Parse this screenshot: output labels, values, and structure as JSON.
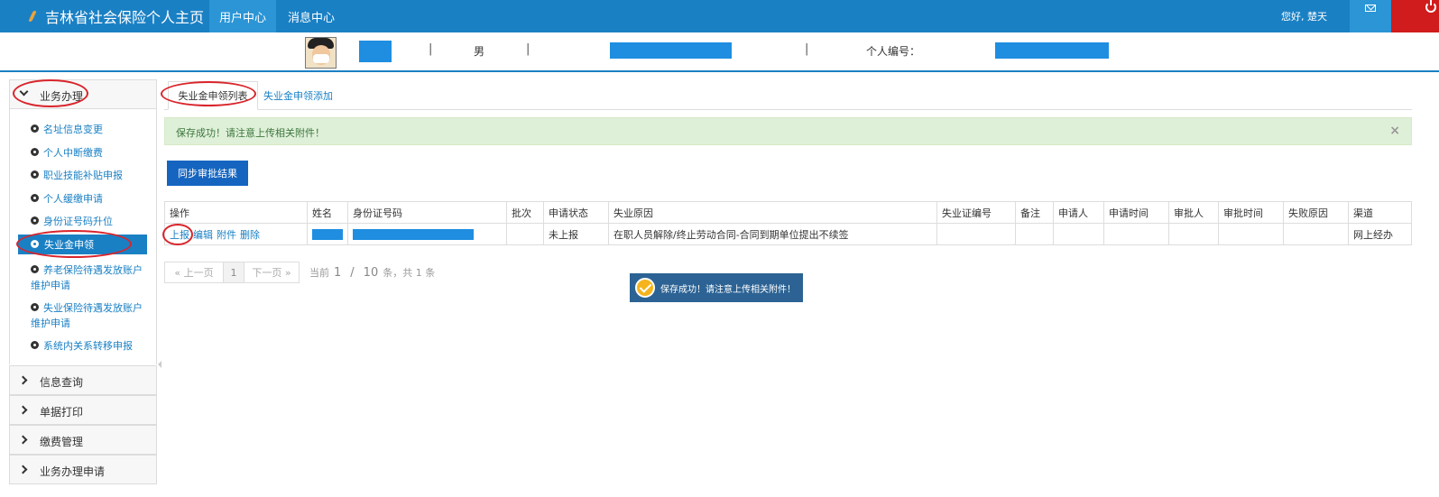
{
  "header": {
    "title": "吉林省社会保险个人主页",
    "nav": [
      "用户中心",
      "消息中心"
    ],
    "greeting": "您好, 楚天"
  },
  "profile": {
    "gender": "男",
    "id_label": "个人编号："
  },
  "sidebar": {
    "groups": [
      "业务办理",
      "信息查询",
      "单据打印",
      "缴费管理",
      "业务办理申请"
    ],
    "items": [
      "名址信息变更",
      "个人中断缴费",
      "职业技能补贴申报",
      "个人缓缴申请",
      "身份证号码升位",
      "失业金申领",
      "养老保险待遇发放账户维护申请",
      "失业保险待遇发放账户维护申请",
      "系统内关系转移申报"
    ]
  },
  "tabs": [
    "失业金申领列表",
    "失业金申领添加"
  ],
  "alert": {
    "message": "保存成功！请注意上传相关附件！",
    "close": "×"
  },
  "sync_button": "同步审批结果",
  "table": {
    "headers": [
      "操作",
      "姓名",
      "身份证号码",
      "批次",
      "申请状态",
      "失业原因",
      "失业证编号",
      "备注",
      "申请人",
      "申请时间",
      "审批人",
      "审批时间",
      "失败原因",
      "渠道"
    ],
    "row": {
      "actions": [
        "上报",
        "编辑",
        "附件",
        "删除"
      ],
      "status": "未上报",
      "reason": "在职人员解除/终止劳动合同-合同到期单位提出不续签",
      "channel": "网上经办"
    }
  },
  "pager": {
    "prev": "« 上一页",
    "page": "1",
    "next": "下一页 »",
    "current_label": "当前",
    "current": "1",
    "slash": "/",
    "total": "10",
    "suffix": "条，共 1 条"
  },
  "toast": "保存成功！请注意上传相关附件！",
  "colors": {
    "primary": "#1a80c4",
    "danger": "#d01c1c",
    "success_bg": "#dff0d8",
    "annotation": "#d9242b"
  }
}
